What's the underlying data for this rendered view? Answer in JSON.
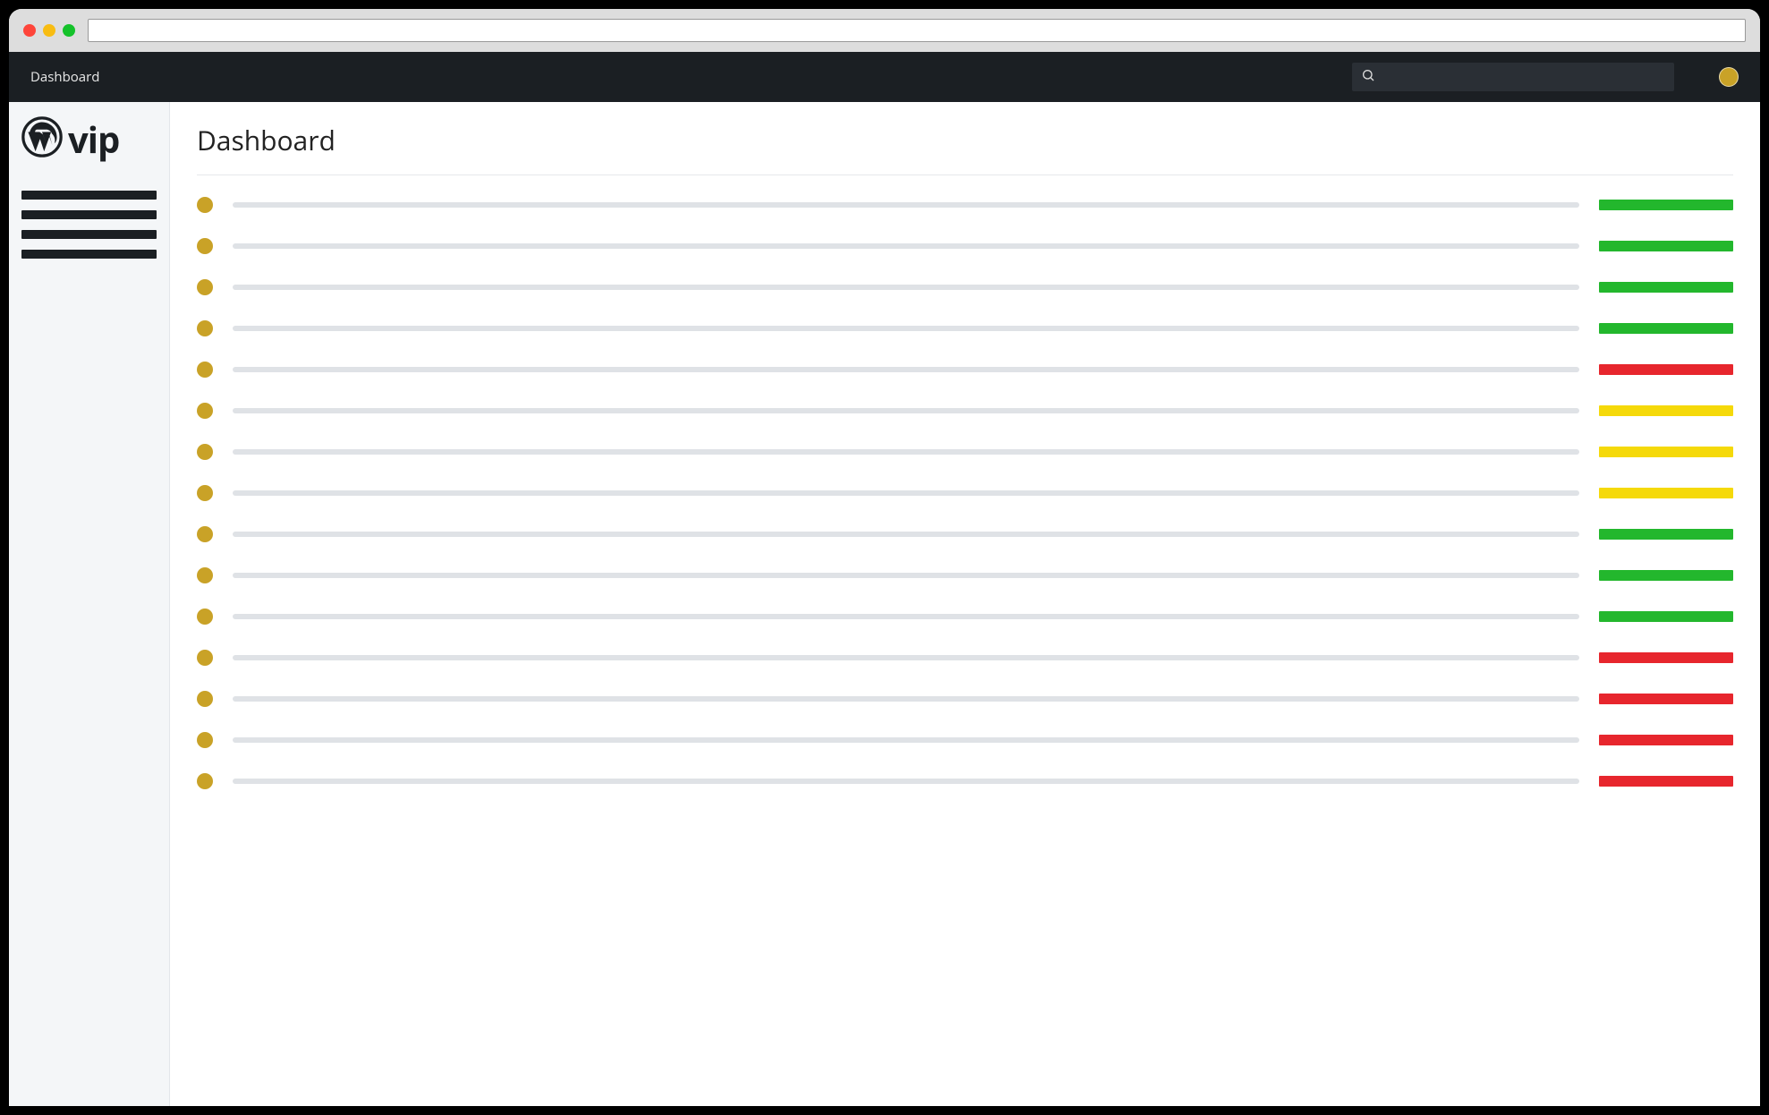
{
  "colors": {
    "chrome_red": "#fe453a",
    "chrome_yellow": "#f8bc12",
    "chrome_green": "#14c22a",
    "accent_gold": "#c9a227",
    "status_green": "#23b72d",
    "status_yellow": "#f5d90a",
    "status_red": "#e7262d",
    "dark": "#1b1f23"
  },
  "topbar": {
    "title": "Dashboard",
    "search_placeholder": ""
  },
  "sidebar": {
    "logo_text": "vip",
    "menu_item_count": 4
  },
  "page": {
    "title": "Dashboard"
  },
  "rows": [
    {
      "status": "green"
    },
    {
      "status": "green"
    },
    {
      "status": "green"
    },
    {
      "status": "green"
    },
    {
      "status": "red"
    },
    {
      "status": "yellow"
    },
    {
      "status": "yellow"
    },
    {
      "status": "yellow"
    },
    {
      "status": "green"
    },
    {
      "status": "green"
    },
    {
      "status": "green"
    },
    {
      "status": "red"
    },
    {
      "status": "red"
    },
    {
      "status": "red"
    },
    {
      "status": "red"
    }
  ]
}
